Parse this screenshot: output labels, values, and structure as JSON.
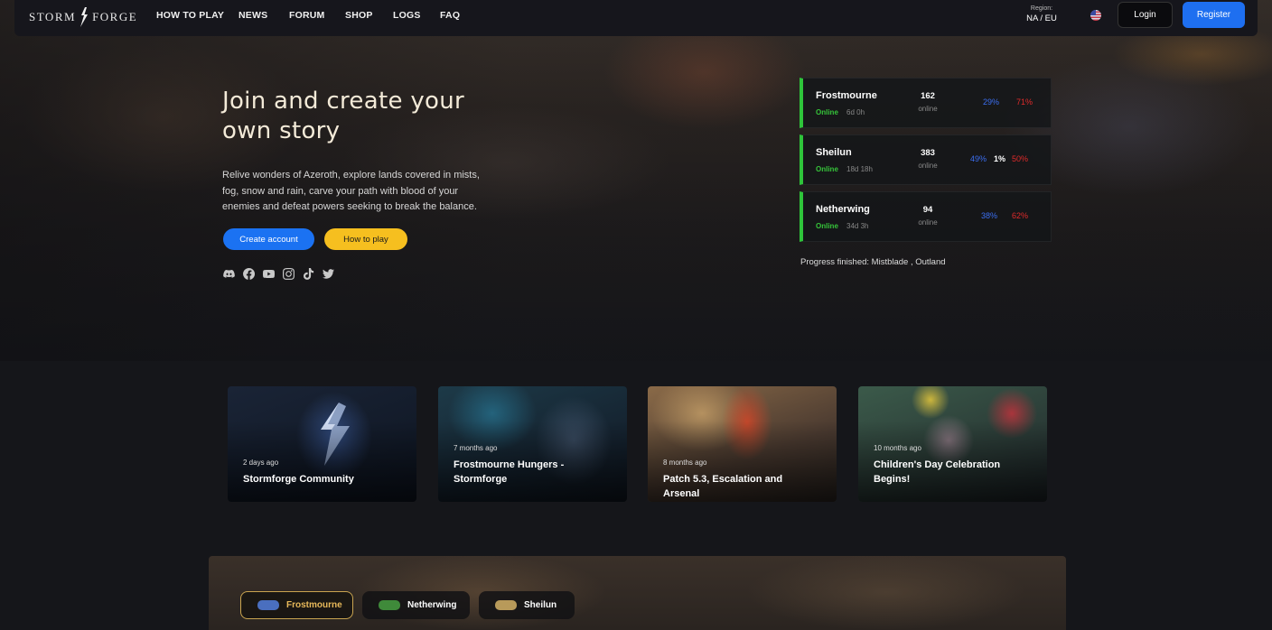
{
  "nav": {
    "logo_left": "STORM",
    "logo_right": "FORGE",
    "links": [
      "HOW TO PLAY",
      "NEWS",
      "FORUM",
      "SHOP",
      "LOGS",
      "FAQ"
    ],
    "region_label": "Region:",
    "region_value": "NA / EU",
    "login": "Login",
    "register": "Register"
  },
  "hero": {
    "title": "Join and create your own story",
    "description": "Relive wonders of Azeroth, explore lands covered in mists, fog, snow and rain, carve your path with blood of your enemies and defeat powers seeking to break the balance.",
    "create_account": "Create account",
    "how_to_play": "How to play",
    "socials": [
      "discord-icon",
      "facebook-icon",
      "youtube-icon",
      "instagram-icon",
      "tiktok-icon",
      "twitter-icon"
    ]
  },
  "realms": [
    {
      "name": "Frostmourne",
      "status": "Online",
      "uptime": "6d 0h",
      "count": "162",
      "online_label": "online",
      "alliance": "29%",
      "neutral": "",
      "horde": "71%"
    },
    {
      "name": "Sheilun",
      "status": "Online",
      "uptime": "18d 18h",
      "count": "383",
      "online_label": "online",
      "alliance": "49%",
      "neutral": "1%",
      "horde": "50%"
    },
    {
      "name": "Netherwing",
      "status": "Online",
      "uptime": "34d 3h",
      "count": "94",
      "online_label": "online",
      "alliance": "38%",
      "neutral": "",
      "horde": "62%"
    }
  ],
  "progress_finished": "Progress finished: Mistblade , Outland",
  "news": [
    {
      "date": "2 days ago",
      "title": "Stormforge Community"
    },
    {
      "date": "7 months ago",
      "title": "Frostmourne Hungers - Stormforge"
    },
    {
      "date": "8 months ago",
      "title": "Patch 5.3, Escalation and Arsenal"
    },
    {
      "date": "10 months ago",
      "title": "Children's Day Celebration Begins!"
    }
  ],
  "realm_tabs": [
    "Frostmourne",
    "Netherwing",
    "Sheilun"
  ],
  "colors": {
    "accent_blue": "#1e6ff0",
    "accent_yellow": "#f6bf1f",
    "online_green": "#2ec43a",
    "horde_red": "#e02a2a",
    "alliance_blue": "#3b6ef0"
  }
}
